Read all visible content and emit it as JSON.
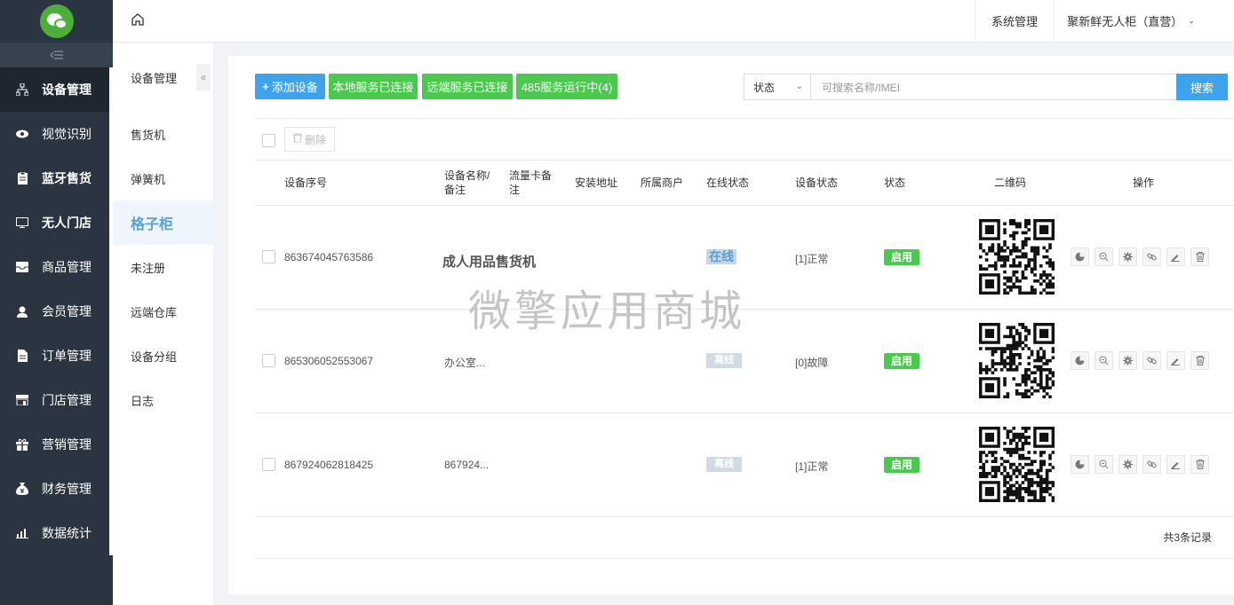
{
  "sidebar": {
    "items": [
      {
        "label": "设备管理",
        "icon": "sitemap-icon"
      },
      {
        "label": "视觉识别",
        "icon": "eye-icon"
      },
      {
        "label": "蓝牙售货",
        "icon": "clipboard-icon"
      },
      {
        "label": "无人门店",
        "icon": "monitor-icon"
      },
      {
        "label": "商品管理",
        "icon": "inbox-icon"
      },
      {
        "label": "会员管理",
        "icon": "user-icon"
      },
      {
        "label": "订单管理",
        "icon": "file-icon"
      },
      {
        "label": "门店管理",
        "icon": "store-icon"
      },
      {
        "label": "营销管理",
        "icon": "gift-icon"
      },
      {
        "label": "财务管理",
        "icon": "money-bag-icon"
      },
      {
        "label": "数据统计",
        "icon": "bar-chart-icon"
      }
    ]
  },
  "header": {
    "system_label": "系统管理",
    "store_label": "聚新鲜无人柜（直营）"
  },
  "submenu": {
    "title": "设备管理",
    "items": [
      "售货机",
      "弹簧机",
      "格子柜",
      "未注册",
      "远端仓库",
      "设备分组",
      "日志"
    ]
  },
  "toolbar": {
    "add_label": "添加设备",
    "local_label": "本地服务已连接",
    "remote_label": "远端服务已连接",
    "service_label": "485服务运行中(4)",
    "status_select": "状态",
    "search_placeholder": "可搜索名称/IMEI",
    "search_label": "搜索",
    "delete_label": "删除"
  },
  "table": {
    "headers": {
      "serial": "设备序号",
      "name_1": "设备名称/",
      "name_2": "备注",
      "sim_1": "流量卡备",
      "sim_2": "注",
      "address": "安装地址",
      "merchant": "所属商户",
      "online": "在线状态",
      "device_status": "设备状态",
      "status": "状态",
      "qrcode": "二维码",
      "actions": "操作"
    },
    "rows": [
      {
        "serial": "863674045763586",
        "name": "成人用品售货机",
        "online": "在线",
        "device_status": "[1]正常",
        "status": "启用"
      },
      {
        "serial": "865306052553067",
        "name": "办公室...",
        "online": "离线",
        "device_status": "[0]故障",
        "status": "启用"
      },
      {
        "serial": "867924062818425",
        "name": "867924...",
        "online": "离线",
        "device_status": "[1]正常",
        "status": "启用"
      }
    ],
    "total": "共3条记录"
  },
  "watermark": "微擎应用商城"
}
